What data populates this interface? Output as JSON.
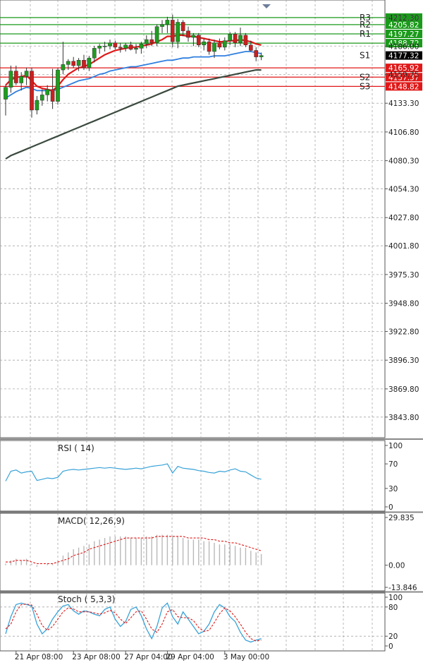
{
  "chart_data": [
    {
      "type": "candlestick",
      "panel": "price",
      "y_axis_ticks": [
        "4212.30",
        "4186.00",
        "4159.75",
        "4133.30",
        "4106.80",
        "4080.30",
        "4054.30",
        "4027.80",
        "4001.80",
        "3975.30",
        "3948.80",
        "3922.80",
        "3896.30",
        "3869.80",
        "3843.80"
      ],
      "ylim": [
        3830,
        4222
      ],
      "candles": [
        {
          "o": 4137.0,
          "h": 4150.0,
          "l": 4122.0,
          "c": 4148.0
        },
        {
          "o": 4148.0,
          "h": 4168.0,
          "l": 4143.0,
          "c": 4163.0
        },
        {
          "o": 4163.0,
          "h": 4168.0,
          "l": 4150.0,
          "c": 4152.0
        },
        {
          "o": 4152.0,
          "h": 4162.0,
          "l": 4145.0,
          "c": 4158.0
        },
        {
          "o": 4158.0,
          "h": 4166.0,
          "l": 4150.0,
          "c": 4163.0
        },
        {
          "o": 4163.0,
          "h": 4166.0,
          "l": 4120.0,
          "c": 4127.0
        },
        {
          "o": 4127.0,
          "h": 4140.0,
          "l": 4123.0,
          "c": 4136.0
        },
        {
          "o": 4136.0,
          "h": 4146.0,
          "l": 4131.0,
          "c": 4141.0
        },
        {
          "o": 4141.0,
          "h": 4150.0,
          "l": 4135.0,
          "c": 4146.0
        },
        {
          "o": 4146.0,
          "h": 4165.0,
          "l": 4128.0,
          "c": 4135.0
        },
        {
          "o": 4135.0,
          "h": 4166.0,
          "l": 4132.0,
          "c": 4164.0
        },
        {
          "o": 4164.0,
          "h": 4190.0,
          "l": 4160.0,
          "c": 4169.0
        },
        {
          "o": 4169.0,
          "h": 4174.0,
          "l": 4164.0,
          "c": 4172.0
        },
        {
          "o": 4172.0,
          "h": 4176.0,
          "l": 4166.0,
          "c": 4168.0
        },
        {
          "o": 4168.0,
          "h": 4175.0,
          "l": 4163.0,
          "c": 4173.0
        },
        {
          "o": 4173.0,
          "h": 4178.0,
          "l": 4164.0,
          "c": 4166.0
        },
        {
          "o": 4166.0,
          "h": 4177.0,
          "l": 4163.0,
          "c": 4175.0
        },
        {
          "o": 4175.0,
          "h": 4186.0,
          "l": 4171.0,
          "c": 4184.0
        },
        {
          "o": 4184.0,
          "h": 4188.0,
          "l": 4179.0,
          "c": 4186.0
        },
        {
          "o": 4186.0,
          "h": 4190.0,
          "l": 4181.0,
          "c": 4186.0
        },
        {
          "o": 4186.0,
          "h": 4192.0,
          "l": 4183.0,
          "c": 4189.0
        },
        {
          "o": 4189.0,
          "h": 4191.0,
          "l": 4183.0,
          "c": 4185.0
        },
        {
          "o": 4185.0,
          "h": 4189.0,
          "l": 4180.0,
          "c": 4184.0
        },
        {
          "o": 4184.0,
          "h": 4189.0,
          "l": 4181.0,
          "c": 4187.0
        },
        {
          "o": 4187.0,
          "h": 4190.0,
          "l": 4182.0,
          "c": 4183.0
        },
        {
          "o": 4183.0,
          "h": 4188.0,
          "l": 4179.0,
          "c": 4184.0
        },
        {
          "o": 4184.0,
          "h": 4190.0,
          "l": 4179.0,
          "c": 4188.0
        },
        {
          "o": 4188.0,
          "h": 4196.0,
          "l": 4184.0,
          "c": 4192.0
        },
        {
          "o": 4192.0,
          "h": 4200.0,
          "l": 4186.0,
          "c": 4189.0
        },
        {
          "o": 4189.0,
          "h": 4206.0,
          "l": 4186.0,
          "c": 4204.0
        },
        {
          "o": 4204.0,
          "h": 4210.0,
          "l": 4198.0,
          "c": 4206.0
        },
        {
          "o": 4206.0,
          "h": 4213.0,
          "l": 4198.0,
          "c": 4210.0
        },
        {
          "o": 4210.0,
          "h": 4215.0,
          "l": 4185.0,
          "c": 4190.0
        },
        {
          "o": 4190.0,
          "h": 4211.0,
          "l": 4184.0,
          "c": 4208.0
        },
        {
          "o": 4208.0,
          "h": 4210.0,
          "l": 4195.0,
          "c": 4200.0
        },
        {
          "o": 4200.0,
          "h": 4204.0,
          "l": 4190.0,
          "c": 4194.0
        },
        {
          "o": 4194.0,
          "h": 4198.0,
          "l": 4186.0,
          "c": 4196.0
        },
        {
          "o": 4196.0,
          "h": 4198.0,
          "l": 4185.0,
          "c": 4187.0
        },
        {
          "o": 4187.0,
          "h": 4193.0,
          "l": 4182.0,
          "c": 4190.0
        },
        {
          "o": 4190.0,
          "h": 4193.0,
          "l": 4178.0,
          "c": 4181.0
        },
        {
          "o": 4181.0,
          "h": 4192.0,
          "l": 4175.0,
          "c": 4189.0
        },
        {
          "o": 4189.0,
          "h": 4193.0,
          "l": 4183.0,
          "c": 4185.0
        },
        {
          "o": 4185.0,
          "h": 4194.0,
          "l": 4182.0,
          "c": 4191.0
        },
        {
          "o": 4191.0,
          "h": 4199.0,
          "l": 4187.0,
          "c": 4197.0
        },
        {
          "o": 4197.0,
          "h": 4199.0,
          "l": 4185.0,
          "c": 4189.0
        },
        {
          "o": 4189.0,
          "h": 4203.0,
          "l": 4186.0,
          "c": 4196.0
        },
        {
          "o": 4196.0,
          "h": 4198.0,
          "l": 4185.0,
          "c": 4187.0
        },
        {
          "o": 4187.0,
          "h": 4191.0,
          "l": 4181.0,
          "c": 4182.0
        },
        {
          "o": 4182.0,
          "h": 4185.0,
          "l": 4172.0,
          "c": 4176.0
        },
        {
          "o": 4176.0,
          "h": 4180.0,
          "l": 4173.0,
          "c": 4177.32
        }
      ],
      "ma_fast": [
        4150,
        4155,
        4157,
        4158,
        4159,
        4154,
        4149,
        4147,
        4146,
        4145,
        4149,
        4155,
        4160,
        4163,
        4166,
        4167,
        4169,
        4172,
        4175,
        4178,
        4180,
        4182,
        4183,
        4184,
        4185,
        4185,
        4186,
        4187,
        4188,
        4190,
        4192,
        4195,
        4195,
        4196,
        4196,
        4195,
        4195,
        4194,
        4193,
        4192,
        4191,
        4190,
        4190,
        4191,
        4191,
        4192,
        4191,
        4190,
        4188,
        4187
      ],
      "ma_mid": [
        4138,
        4141,
        4144,
        4146,
        4148,
        4147,
        4145,
        4145,
        4145,
        4145,
        4146,
        4148,
        4150,
        4152,
        4154,
        4155,
        4156,
        4158,
        4160,
        4161,
        4163,
        4164,
        4165,
        4166,
        4167,
        4167,
        4168,
        4169,
        4170,
        4171,
        4172,
        4173,
        4173,
        4174,
        4175,
        4175,
        4176,
        4176,
        4176,
        4176,
        4177,
        4177,
        4177,
        4178,
        4179,
        4180,
        4181,
        4181,
        4180,
        4179
      ],
      "ma_slow": [
        4082,
        4085,
        4087,
        4089,
        4091,
        4093,
        4095,
        4097,
        4099,
        4101,
        4103,
        4105,
        4107,
        4109,
        4111,
        4113,
        4115,
        4117,
        4119,
        4121,
        4123,
        4125,
        4127,
        4129,
        4131,
        4133,
        4135,
        4137,
        4139,
        4141,
        4143,
        4145,
        4147,
        4149,
        4150,
        4151,
        4152,
        4153,
        4154,
        4155,
        4156,
        4157,
        4158,
        4159,
        4160,
        4161,
        4162,
        4163,
        4164,
        4164
      ],
      "levels": [
        {
          "name": "R3",
          "value": 4212.3,
          "label": "4212.30",
          "kind": "resistance"
        },
        {
          "name": "R2",
          "value": 4205.82,
          "label": "4205.82",
          "kind": "resistance"
        },
        {
          "name": "R1",
          "value": 4197.27,
          "label": "4197.27",
          "kind": "resistance"
        },
        {
          "name": "",
          "value": 4188.72,
          "label": "4188.72",
          "kind": "resistance"
        },
        {
          "name": "S1",
          "value": 4177.32,
          "label": "4177.32",
          "kind": "current"
        },
        {
          "name": "",
          "value": 4165.92,
          "label": "4165.92",
          "kind": "support"
        },
        {
          "name": "S2",
          "value": 4157.37,
          "label": "4157.37",
          "kind": "support"
        },
        {
          "name": "S3",
          "value": 4148.82,
          "label": "4148.82",
          "kind": "support"
        }
      ],
      "x_tick_labels": [
        "21 Apr 08:00",
        "23 Apr 08:00",
        "27 Apr 04:00",
        "29 Apr 04:00",
        "3 May 00:00"
      ],
      "x_tick_candle_index": [
        2,
        13,
        23,
        31,
        42
      ],
      "colors": {
        "bull": "#1e9e1e",
        "bear": "#cc1f1f",
        "ma_fast": "#e01818",
        "ma_mid": "#2f7fe0",
        "ma_slow": "#3b4a3f",
        "resistance": "#1a9a1a",
        "support": "#e01818",
        "grid": "#a8a8a8"
      }
    },
    {
      "type": "line",
      "panel": "indicator",
      "title": "RSI ( 14)",
      "ylim": [
        0,
        100
      ],
      "y_ticks": [
        "100",
        "70",
        "30",
        "0"
      ],
      "y_tick_values": [
        100,
        70,
        30,
        0
      ],
      "series": [
        {
          "name": "RSI",
          "values": [
            42,
            58,
            60,
            55,
            57,
            58,
            43,
            45,
            47,
            46,
            48,
            58,
            60,
            61,
            60,
            61,
            62,
            63,
            64,
            63,
            64,
            63,
            62,
            61,
            62,
            63,
            62,
            64,
            66,
            67,
            68,
            70,
            55,
            66,
            63,
            62,
            61,
            59,
            58,
            56,
            55,
            58,
            57,
            60,
            62,
            58,
            57,
            52,
            47,
            45
          ]
        }
      ]
    },
    {
      "type": "bar+line",
      "panel": "indicator",
      "title": "MACD( 12,26,9)",
      "ylim": [
        -13.846,
        29.835
      ],
      "y_ticks": [
        "29.835",
        "0.00",
        "-13.846"
      ],
      "y_tick_values": [
        29.835,
        0,
        -13.846
      ],
      "series": [
        {
          "name": "MACD",
          "values": [
            1,
            3,
            4,
            3,
            4,
            1,
            -1,
            0,
            1,
            1,
            3,
            6,
            8,
            10,
            11,
            12,
            13,
            15,
            16,
            17,
            18,
            18,
            18,
            18,
            17,
            17,
            17,
            18,
            18,
            19,
            19,
            19,
            18,
            18,
            17,
            16,
            16,
            16,
            15,
            15,
            14,
            13,
            13,
            13,
            12,
            11,
            11,
            9,
            8,
            7
          ]
        },
        {
          "name": "Signal",
          "values": [
            2,
            2,
            3,
            3,
            3,
            2,
            1,
            1,
            1,
            1,
            2,
            3,
            4,
            6,
            7,
            8,
            10,
            11,
            12,
            13,
            14,
            15,
            16,
            17,
            17,
            17,
            17,
            17,
            17,
            18,
            18,
            18,
            18,
            18,
            18,
            17,
            17,
            17,
            17,
            16,
            16,
            15,
            15,
            14,
            14,
            13,
            12,
            11,
            10,
            9
          ]
        }
      ]
    },
    {
      "type": "line",
      "panel": "indicator",
      "title": "Stoch ( 5,3,3)",
      "ylim": [
        0,
        100
      ],
      "y_ticks": [
        "100",
        "80",
        "20",
        "0"
      ],
      "y_tick_values": [
        100,
        80,
        20,
        0
      ],
      "series": [
        {
          "name": "Main",
          "values": [
            25,
            60,
            85,
            88,
            85,
            82,
            45,
            25,
            35,
            55,
            70,
            82,
            85,
            72,
            65,
            72,
            70,
            65,
            62,
            75,
            80,
            55,
            40,
            50,
            75,
            80,
            62,
            35,
            15,
            40,
            78,
            88,
            60,
            45,
            70,
            55,
            40,
            25,
            30,
            45,
            70,
            85,
            78,
            60,
            50,
            28,
            12,
            8,
            12,
            15
          ]
        },
        {
          "name": "Signal",
          "values": [
            35,
            45,
            70,
            85,
            86,
            84,
            65,
            42,
            32,
            40,
            55,
            70,
            78,
            76,
            70,
            70,
            70,
            68,
            65,
            68,
            73,
            68,
            55,
            46,
            58,
            70,
            72,
            55,
            35,
            28,
            45,
            70,
            75,
            60,
            58,
            58,
            52,
            38,
            30,
            32,
            48,
            66,
            78,
            72,
            60,
            45,
            28,
            15,
            10,
            12
          ]
        }
      ]
    }
  ],
  "colors": {
    "line_blue": "#38a2d8",
    "dash_red": "#e01818",
    "text": "#222222",
    "axis_bg": "#ffffff",
    "border": "#555555"
  }
}
